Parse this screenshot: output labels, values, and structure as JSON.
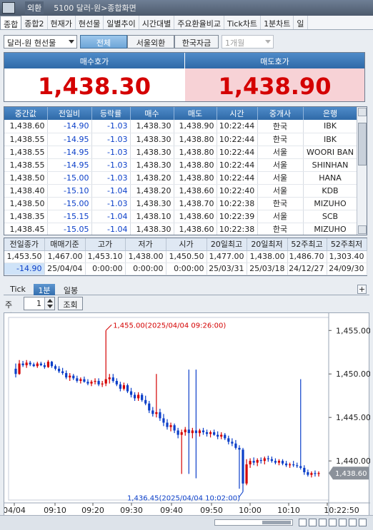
{
  "titlebar": {
    "window_label": "외환",
    "title": "5100 달러-원>종합화면"
  },
  "tabs": [
    "종합",
    "종합2",
    "현재가",
    "현선물",
    "일별추이",
    "시간대별",
    "주요환율비교",
    "Tick차트",
    "1분차트",
    "일"
  ],
  "toolbar": {
    "instrument": "달러-원 현선물",
    "segments": [
      "전체",
      "서울외환",
      "한국자금"
    ],
    "period_select": "1개월"
  },
  "quote": {
    "bid_label": "매수호가",
    "bid_value": "1,438.30",
    "ask_label": "매도호가",
    "ask_value": "1,438.90"
  },
  "trades": {
    "headers": [
      "중간값",
      "전일비",
      "등락률",
      "매수",
      "매도",
      "시간",
      "중개사",
      "은행"
    ],
    "rows": [
      [
        "1,438.60",
        "-14.90",
        "-1.03",
        "1,438.30",
        "1,438.90",
        "10:22:44",
        "한국",
        "IBK"
      ],
      [
        "1,438.55",
        "-14.95",
        "-1.03",
        "1,438.30",
        "1,438.80",
        "10:22:44",
        "한국",
        "IBK"
      ],
      [
        "1,438.55",
        "-14.95",
        "-1.03",
        "1,438.30",
        "1,438.80",
        "10:22:44",
        "서울",
        "WOORI BAN"
      ],
      [
        "1,438.55",
        "-14.95",
        "-1.03",
        "1,438.30",
        "1,438.80",
        "10:22:44",
        "서울",
        "SHINHAN"
      ],
      [
        "1,438.50",
        "-15.00",
        "-1.03",
        "1,438.20",
        "1,438.80",
        "10:22:44",
        "서울",
        "HANA"
      ],
      [
        "1,438.40",
        "-15.10",
        "-1.04",
        "1,438.20",
        "1,438.60",
        "10:22:40",
        "서울",
        "KDB"
      ],
      [
        "1,438.50",
        "-15.00",
        "-1.03",
        "1,438.30",
        "1,438.70",
        "10:22:38",
        "한국",
        "MIZUHO"
      ],
      [
        "1,438.35",
        "-15.15",
        "-1.04",
        "1,438.10",
        "1,438.60",
        "10:22:39",
        "서울",
        "SCB"
      ],
      [
        "1,438.45",
        "-15.05",
        "-1.04",
        "1,438.30",
        "1,438.60",
        "10:22:38",
        "한국",
        "MIZUHO"
      ]
    ]
  },
  "summary": {
    "headers": [
      "전일종가",
      "매매기준",
      "고가",
      "저가",
      "시가",
      "20일최고",
      "20일최저",
      "52주최고",
      "52주최저"
    ],
    "row1": [
      "1,453.50",
      "1,467.00",
      "1,453.10",
      "1,438.00",
      "1,450.50",
      "1,477.00",
      "1,438.00",
      "1,486.70",
      "1,303.40"
    ],
    "row2": [
      "-14.90",
      "25/04/04",
      "0:00:00",
      "0:00:00",
      "0:00:00",
      "25/03/31",
      "25/03/18",
      "24/12/27",
      "24/09/30"
    ]
  },
  "chart_tabs": [
    "Tick",
    "1분",
    "일봉"
  ],
  "period": {
    "label": "주기",
    "value": "1",
    "query_button": "조회"
  },
  "chart_data": {
    "type": "candlestick",
    "y_ticks": [
      "1,455.00",
      "1,450.00",
      "1,445.00",
      "1,440.00"
    ],
    "ylim": [
      1435.5,
      1456.5
    ],
    "x_ticks": [
      "04/04",
      "09:10",
      "09:20",
      "09:30",
      "09:40",
      "09:50",
      "10:00",
      "10:10",
      "10:22:50"
    ],
    "annotation_high": "1,455.00(2025/04/04 09:26:00)",
    "annotation_low": "1,436.45(2025/04/04 10:02:00)",
    "last_price": "1,438.60",
    "up_color": "#d40000",
    "down_color": "#0b3fc9",
    "candles": [
      {
        "o": 1450.6,
        "h": 1451.2,
        "l": 1449.6,
        "c": 1450.0
      },
      {
        "o": 1450.0,
        "h": 1451.6,
        "l": 1449.9,
        "c": 1451.2
      },
      {
        "o": 1451.2,
        "h": 1451.5,
        "l": 1450.8,
        "c": 1451.0
      },
      {
        "o": 1451.0,
        "h": 1451.6,
        "l": 1450.7,
        "c": 1451.3
      },
      {
        "o": 1451.3,
        "h": 1451.5,
        "l": 1450.9,
        "c": 1451.1
      },
      {
        "o": 1451.1,
        "h": 1451.3,
        "l": 1450.8,
        "c": 1450.9
      },
      {
        "o": 1450.9,
        "h": 1451.4,
        "l": 1450.7,
        "c": 1451.2
      },
      {
        "o": 1451.2,
        "h": 1451.4,
        "l": 1450.9,
        "c": 1451.0
      },
      {
        "o": 1451.0,
        "h": 1451.3,
        "l": 1450.6,
        "c": 1450.8
      },
      {
        "o": 1450.8,
        "h": 1451.6,
        "l": 1450.7,
        "c": 1451.4
      },
      {
        "o": 1451.4,
        "h": 1451.5,
        "l": 1450.7,
        "c": 1450.9
      },
      {
        "o": 1450.9,
        "h": 1451.1,
        "l": 1450.4,
        "c": 1450.6
      },
      {
        "o": 1450.6,
        "h": 1450.9,
        "l": 1450.1,
        "c": 1450.3
      },
      {
        "o": 1450.3,
        "h": 1450.7,
        "l": 1449.9,
        "c": 1450.1
      },
      {
        "o": 1450.1,
        "h": 1450.4,
        "l": 1449.4,
        "c": 1449.6
      },
      {
        "o": 1449.6,
        "h": 1450.1,
        "l": 1449.2,
        "c": 1449.8
      },
      {
        "o": 1449.8,
        "h": 1450.0,
        "l": 1449.3,
        "c": 1449.5
      },
      {
        "o": 1449.5,
        "h": 1449.8,
        "l": 1449.0,
        "c": 1449.2
      },
      {
        "o": 1449.2,
        "h": 1449.6,
        "l": 1448.9,
        "c": 1449.4
      },
      {
        "o": 1449.4,
        "h": 1449.7,
        "l": 1449.0,
        "c": 1449.1
      },
      {
        "o": 1449.1,
        "h": 1449.4,
        "l": 1448.7,
        "c": 1448.9
      },
      {
        "o": 1448.9,
        "h": 1449.3,
        "l": 1448.6,
        "c": 1449.1
      },
      {
        "o": 1449.1,
        "h": 1449.5,
        "l": 1448.8,
        "c": 1449.2
      },
      {
        "o": 1449.2,
        "h": 1449.5,
        "l": 1448.6,
        "c": 1448.8
      },
      {
        "o": 1448.8,
        "h": 1449.2,
        "l": 1448.5,
        "c": 1448.9
      },
      {
        "o": 1448.9,
        "h": 1455.0,
        "l": 1448.6,
        "c": 1449.4
      },
      {
        "o": 1449.4,
        "h": 1450.0,
        "l": 1448.9,
        "c": 1449.6
      },
      {
        "o": 1449.6,
        "h": 1450.0,
        "l": 1449.0,
        "c": 1449.2
      },
      {
        "o": 1449.2,
        "h": 1449.5,
        "l": 1448.6,
        "c": 1448.8
      },
      {
        "o": 1448.8,
        "h": 1449.1,
        "l": 1448.0,
        "c": 1448.3
      },
      {
        "o": 1448.3,
        "h": 1449.0,
        "l": 1448.1,
        "c": 1448.7
      },
      {
        "o": 1448.7,
        "h": 1448.9,
        "l": 1447.8,
        "c": 1448.0
      },
      {
        "o": 1448.0,
        "h": 1448.4,
        "l": 1447.3,
        "c": 1447.6
      },
      {
        "o": 1447.6,
        "h": 1447.9,
        "l": 1446.9,
        "c": 1447.2
      },
      {
        "o": 1447.2,
        "h": 1447.9,
        "l": 1446.9,
        "c": 1447.6
      },
      {
        "o": 1447.6,
        "h": 1447.8,
        "l": 1446.8,
        "c": 1447.0
      },
      {
        "o": 1447.0,
        "h": 1447.5,
        "l": 1446.4,
        "c": 1446.6
      },
      {
        "o": 1446.6,
        "h": 1446.9,
        "l": 1445.5,
        "c": 1445.8
      },
      {
        "o": 1445.8,
        "h": 1446.2,
        "l": 1445.1,
        "c": 1445.4
      },
      {
        "o": 1445.4,
        "h": 1450.0,
        "l": 1445.0,
        "c": 1445.6
      },
      {
        "o": 1445.6,
        "h": 1446.0,
        "l": 1444.6,
        "c": 1444.9
      },
      {
        "o": 1444.9,
        "h": 1445.4,
        "l": 1444.0,
        "c": 1444.4
      },
      {
        "o": 1444.4,
        "h": 1444.8,
        "l": 1443.6,
        "c": 1443.9
      },
      {
        "o": 1443.9,
        "h": 1444.4,
        "l": 1443.4,
        "c": 1444.1
      },
      {
        "o": 1444.1,
        "h": 1444.3,
        "l": 1443.2,
        "c": 1443.5
      },
      {
        "o": 1443.5,
        "h": 1443.8,
        "l": 1442.6,
        "c": 1443.0
      },
      {
        "o": 1443.0,
        "h": 1443.6,
        "l": 1438.5,
        "c": 1443.3
      },
      {
        "o": 1443.3,
        "h": 1443.9,
        "l": 1442.9,
        "c": 1443.6
      },
      {
        "o": 1443.6,
        "h": 1450.5,
        "l": 1438.5,
        "c": 1443.2
      },
      {
        "o": 1443.2,
        "h": 1443.8,
        "l": 1442.6,
        "c": 1443.5
      },
      {
        "o": 1443.5,
        "h": 1450.5,
        "l": 1438.0,
        "c": 1443.2
      },
      {
        "o": 1443.2,
        "h": 1443.7,
        "l": 1442.8,
        "c": 1443.5
      },
      {
        "o": 1443.5,
        "h": 1443.8,
        "l": 1443.0,
        "c": 1443.3
      },
      {
        "o": 1443.3,
        "h": 1443.6,
        "l": 1442.8,
        "c": 1443.1
      },
      {
        "o": 1443.1,
        "h": 1443.5,
        "l": 1442.7,
        "c": 1443.3
      },
      {
        "o": 1443.3,
        "h": 1443.6,
        "l": 1442.9,
        "c": 1443.0
      },
      {
        "o": 1443.0,
        "h": 1443.4,
        "l": 1442.5,
        "c": 1442.8
      },
      {
        "o": 1442.8,
        "h": 1443.3,
        "l": 1442.5,
        "c": 1443.0
      },
      {
        "o": 1443.0,
        "h": 1443.2,
        "l": 1442.4,
        "c": 1442.6
      },
      {
        "o": 1442.6,
        "h": 1442.9,
        "l": 1441.9,
        "c": 1442.2
      },
      {
        "o": 1442.2,
        "h": 1442.6,
        "l": 1441.7,
        "c": 1442.0
      },
      {
        "o": 1442.0,
        "h": 1442.4,
        "l": 1441.3,
        "c": 1441.5
      },
      {
        "o": 1441.5,
        "h": 1441.8,
        "l": 1436.8,
        "c": 1441.3
      },
      {
        "o": 1441.3,
        "h": 1441.5,
        "l": 1436.45,
        "c": 1437.4
      },
      {
        "o": 1437.4,
        "h": 1440.2,
        "l": 1437.2,
        "c": 1439.6
      },
      {
        "o": 1439.6,
        "h": 1440.3,
        "l": 1439.2,
        "c": 1440.0
      },
      {
        "o": 1440.0,
        "h": 1440.4,
        "l": 1439.5,
        "c": 1439.8
      },
      {
        "o": 1439.8,
        "h": 1440.3,
        "l": 1439.4,
        "c": 1440.1
      },
      {
        "o": 1440.1,
        "h": 1440.4,
        "l": 1439.7,
        "c": 1440.0
      },
      {
        "o": 1440.0,
        "h": 1440.5,
        "l": 1439.6,
        "c": 1440.3
      },
      {
        "o": 1440.3,
        "h": 1440.6,
        "l": 1439.9,
        "c": 1440.2
      },
      {
        "o": 1440.2,
        "h": 1440.5,
        "l": 1439.8,
        "c": 1440.0
      },
      {
        "o": 1440.0,
        "h": 1440.3,
        "l": 1439.6,
        "c": 1439.8
      },
      {
        "o": 1439.8,
        "h": 1440.2,
        "l": 1439.5,
        "c": 1440.0
      },
      {
        "o": 1440.0,
        "h": 1440.2,
        "l": 1439.5,
        "c": 1439.7
      },
      {
        "o": 1439.7,
        "h": 1440.0,
        "l": 1439.3,
        "c": 1439.5
      },
      {
        "o": 1439.5,
        "h": 1439.8,
        "l": 1439.2,
        "c": 1439.6
      },
      {
        "o": 1439.6,
        "h": 1440.0,
        "l": 1439.3,
        "c": 1439.5
      },
      {
        "o": 1439.5,
        "h": 1439.8,
        "l": 1439.2,
        "c": 1439.4
      },
      {
        "o": 1439.4,
        "h": 1449.4,
        "l": 1439.0,
        "c": 1439.2
      },
      {
        "o": 1439.2,
        "h": 1439.5,
        "l": 1438.4,
        "c": 1438.7
      },
      {
        "o": 1438.7,
        "h": 1439.0,
        "l": 1438.2,
        "c": 1438.4
      },
      {
        "o": 1438.4,
        "h": 1438.8,
        "l": 1438.1,
        "c": 1438.6
      },
      {
        "o": 1438.6,
        "h": 1438.9,
        "l": 1438.2,
        "c": 1438.5
      },
      {
        "o": 1438.5,
        "h": 1438.8,
        "l": 1438.2,
        "c": 1438.6
      }
    ]
  }
}
